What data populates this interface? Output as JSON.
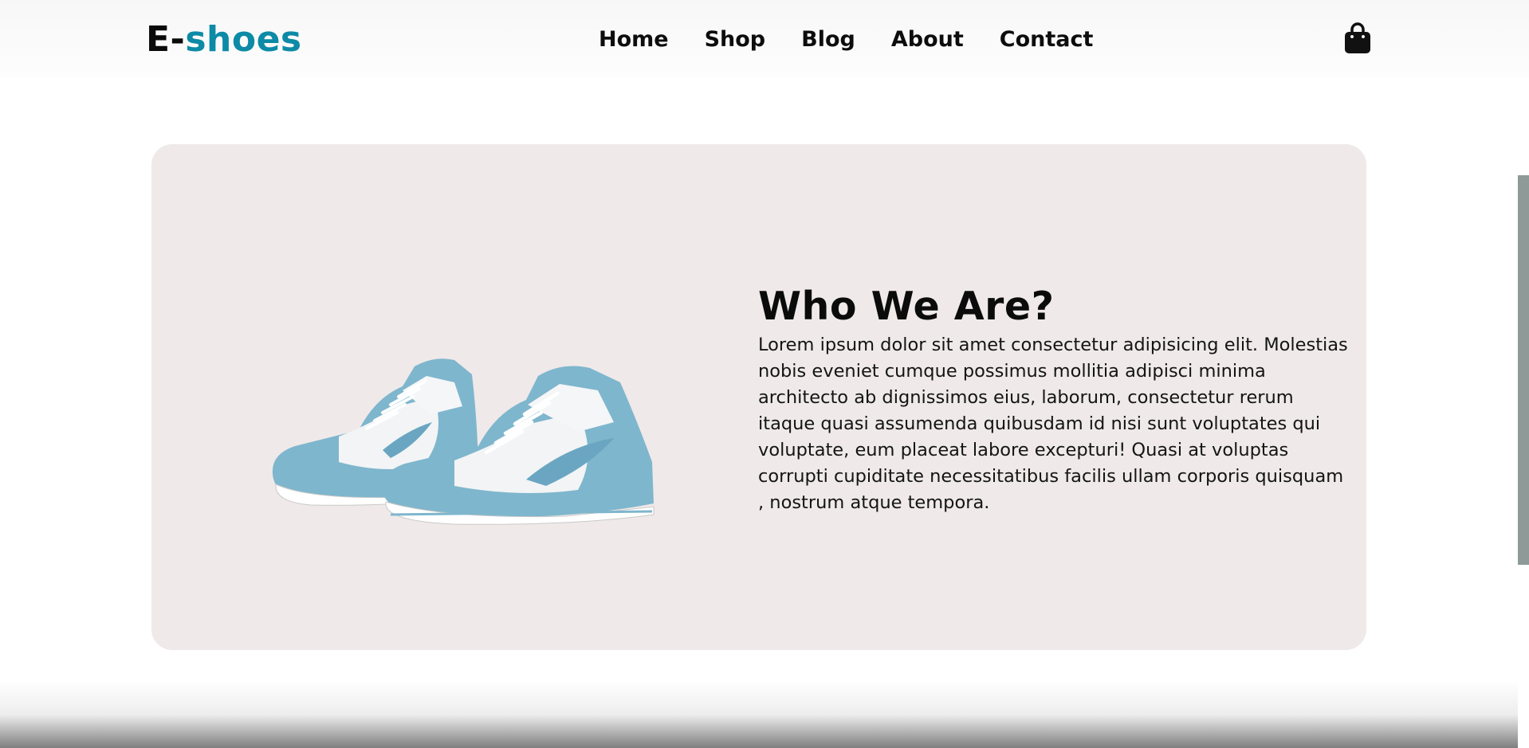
{
  "brand": {
    "prefix": "E-",
    "accent": "shoes",
    "accent_color": "#0c8aa6"
  },
  "nav": {
    "links": [
      {
        "label": "Home"
      },
      {
        "label": "Shop"
      },
      {
        "label": "Blog"
      },
      {
        "label": "About"
      },
      {
        "label": "Contact"
      }
    ],
    "cart_icon": "shopping-bag-icon"
  },
  "about": {
    "title": "Who We Are?",
    "text": "Lorem ipsum dolor sit amet consectetur adipisicing elit. Molestias nobis eveniet cumque possimus mollitia adipisci minima architecto ab dignissimos eius, laborum, consectetur rerum itaque quasi assumenda quibusdam id nisi sunt voluptates qui voluptate, eum placeat labore excepturi! Quasi at voluptas corrupti cupiditate necessitatibus facilis ullam corporis quisquam , nostrum atque tempora.",
    "image": "sneakers-image",
    "card_color": "#efe9e9"
  }
}
